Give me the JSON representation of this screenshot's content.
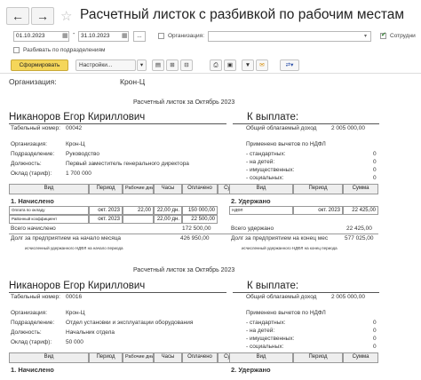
{
  "window": {
    "title": "Расчетный листок с разбивкой по рабочим местам",
    "back_glyph": "←",
    "forward_glyph": "→",
    "star_glyph": "☆"
  },
  "params": {
    "date_from": "01.10.2023",
    "date_to": "31.10.2023",
    "dash": "-",
    "dots": "...",
    "org_label": "Организация:",
    "split_label": "Разбивать по подразделениям",
    "employees_label": "Сотрудни"
  },
  "toolbar": {
    "generate": "Сформировать",
    "settings": "Настройки..."
  },
  "sheet": {
    "org_label": "Организация:",
    "org_name": "Крон-Ц",
    "title": "Расчетный листок за Октябрь 2023",
    "to_pay": "К выплате:",
    "h_vid": "Вид",
    "h_period": "Период",
    "h_workdays": "Рабочие дни",
    "h_hours": "Часы",
    "h_paid": "Оплачено",
    "h_sum": "Сумма",
    "sec_accrued": "1. Начислено",
    "sec_withheld": "2. Удержано",
    "total_income_label": "Общий облагаемый доход",
    "deductions_label": "Применено вычетов по НДФЛ",
    "std": "- стандартных:",
    "kids": "- на детей:",
    "property": "- имущественных:",
    "social": "- социальных:",
    "tab_label": "Табельный номер:",
    "org_f": "Организация:",
    "dept_f": "Подразделение:",
    "pos_f": "Должность:",
    "salary_f": "Оклад (тариф):"
  },
  "employees": [
    {
      "name": "Никаноров Егор Кириллович",
      "tab": "00042",
      "org": "Крон-Ц",
      "dept": "Руководство",
      "position": "Первый заместитель генерального директора",
      "salary": "1 700 000",
      "total_income": "2 005 000,00",
      "std": "0",
      "kids": "0",
      "property": "0",
      "social": "0",
      "accruals": [
        {
          "vid": "Оплата по окладу",
          "period": "окт. 2023",
          "days": "22,00",
          "hours": "22,00 дн.",
          "paid": "150 000,00"
        },
        {
          "vid": "Районный коэффициент",
          "period": "окт. 2023",
          "days": "",
          "hours": "22,00 дн.",
          "paid": "22 500,00"
        }
      ],
      "withholdings": [
        {
          "vid": "НДФЛ",
          "period": "окт. 2023",
          "sum": "22 425,00"
        }
      ],
      "total_accrued_label": "Всего начислено",
      "total_accrued": "172 500,00",
      "total_withheld_label": "Всего удержано",
      "total_withheld": "22 425,00",
      "debt_start_label": "Долг за предприятием на начало месяца",
      "debt_start": "426 950,00",
      "debt_end_label": "Долг за предприятием на конец мес",
      "debt_end": "577 025,00",
      "note1": "исчисленный удержанного НДФЛ на начало периода",
      "note2": "исчисленный удержанного НДФЛ на конец периода"
    },
    {
      "name": "Никаноров Егор Кириллович",
      "tab": "00016",
      "org": "Крон-Ц",
      "dept": "Отдел установки и эксплуатации оборудования",
      "position": "Начальник отдела",
      "salary": "50 000",
      "total_income": "2 005 000,00",
      "std": "0",
      "kids": "0",
      "property": "0",
      "social": "0"
    }
  ]
}
